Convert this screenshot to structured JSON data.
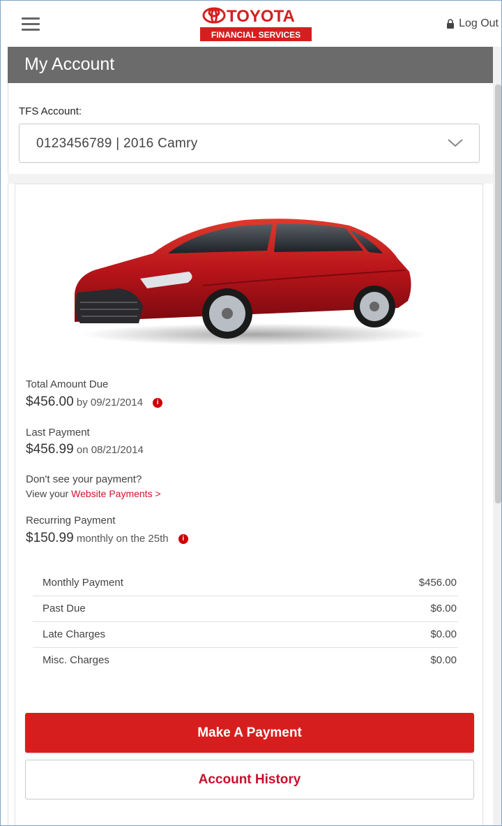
{
  "brand": {
    "logo_text": "TOYOTA",
    "logo_subtext": "FINANCIAL SERVICES",
    "brand_red": "#d71e1e"
  },
  "topbar": {
    "menu_icon": "hamburger-icon",
    "logout_label": "Log Out",
    "logout_icon": "lock-icon"
  },
  "header": {
    "title": "My Account"
  },
  "account": {
    "label": "TFS Account:",
    "selected": "0123456789 | 2016 Camry",
    "dropdown_icon": "chevron-down-icon"
  },
  "summary": {
    "total_due_label": "Total Amount Due",
    "total_due_amount": "$456.00",
    "total_due_date": "by 09/21/2014",
    "last_payment_label": "Last Payment",
    "last_payment_amount": "$456.99",
    "last_payment_date": "on 08/21/2014",
    "missing_payment_q": "Don't see your payment?",
    "view_your": "View your",
    "website_payments_link": "Website Payments >",
    "recurring_label": "Recurring Payment",
    "recurring_amount": "$150.99",
    "recurring_schedule": "monthly on the 25th",
    "info_icon": "info-icon"
  },
  "breakdown": [
    {
      "label": "Monthly Payment",
      "amount": "$456.00"
    },
    {
      "label": "Past Due",
      "amount": "$6.00"
    },
    {
      "label": "Late Charges",
      "amount": "$0.00"
    },
    {
      "label": "Misc. Charges",
      "amount": "$0.00"
    }
  ],
  "actions": {
    "make_payment": "Make A Payment",
    "account_history": "Account History"
  }
}
